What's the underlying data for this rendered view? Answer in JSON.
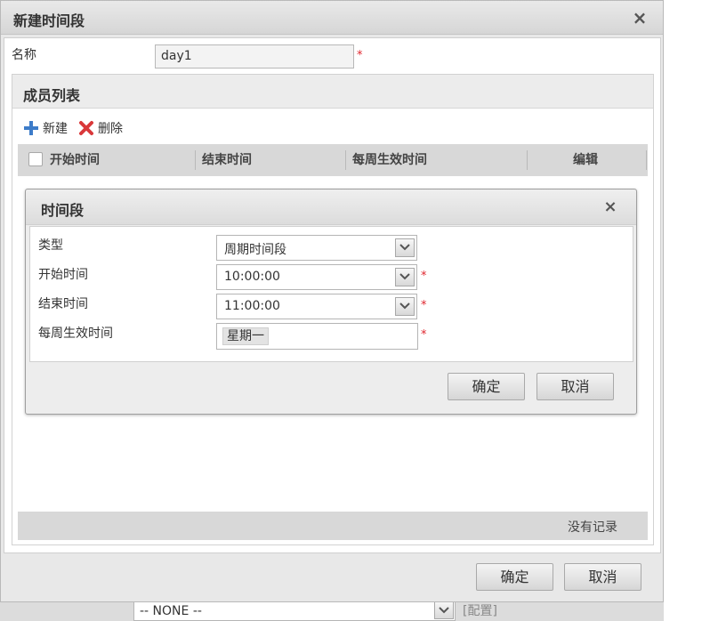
{
  "dialog": {
    "title": "新建时间段",
    "close_icon": "×",
    "name_label": "名称",
    "name_value": "day1",
    "required_mark": "*",
    "ok_label": "确定",
    "cancel_label": "取消"
  },
  "member_panel": {
    "title": "成员列表",
    "toolbar": {
      "add_label": "新建",
      "delete_label": "删除"
    },
    "columns": [
      "开始时间",
      "结束时间",
      "每周生效时间",
      "编辑"
    ],
    "empty_text": "没有记录"
  },
  "period_dialog": {
    "title": "时间段",
    "close_icon": "×",
    "fields": {
      "type_label": "类型",
      "type_value": "周期时间段",
      "start_label": "开始时间",
      "start_value": "10:00:00",
      "end_label": "结束时间",
      "end_value": "11:00:00",
      "weekly_label": "每周生效时间",
      "weekly_tags": [
        "星期一"
      ]
    },
    "ok_label": "确定",
    "cancel_label": "取消"
  },
  "background": {
    "select_value": "-- NONE --",
    "tag_text": "[配置]"
  },
  "colors": {
    "required": "#e0262e",
    "add_icon": "#3d7cc9",
    "delete_icon": "#d9383a"
  }
}
